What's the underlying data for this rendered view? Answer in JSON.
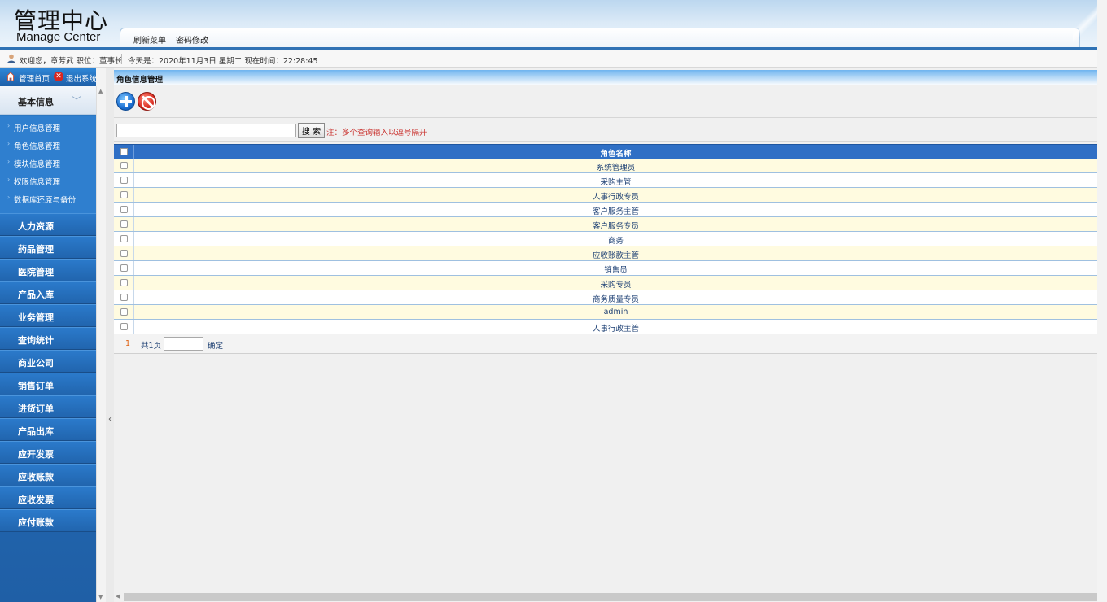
{
  "header": {
    "title": "管理中心",
    "subtitle": "Manage Center",
    "tabs": [
      "刷新菜单",
      "密码修改"
    ]
  },
  "infobar": {
    "welcome": "欢迎您，章芳武  职位：董事长",
    "datetime": "今天是：2020年11月3日 星期二 现在时间：22:28:45"
  },
  "sidebar": {
    "home_label": "管理首页",
    "exit_label": "退出系统",
    "group_label": "基本信息",
    "sub_items": [
      "用户信息管理",
      "角色信息管理",
      "模块信息管理",
      "权限信息管理",
      "数据库还原与备份"
    ],
    "menu_items": [
      "人力资源",
      "药品管理",
      "医院管理",
      "产品入库",
      "业务管理",
      "查询统计",
      "商业公司",
      "销售订单",
      "进货订单",
      "产品出库",
      "应开发票",
      "应收账款",
      "应收发票",
      "应付账款"
    ]
  },
  "main": {
    "title": "角色信息管理",
    "search_button": "搜 索",
    "search_note": "注：多个查询输入以逗号隔开",
    "column_header": "角色名称",
    "rows": [
      "系统管理员",
      "采购主管",
      "人事行政专员",
      "客户服务主管",
      "客户服务专员",
      "商务",
      "应收账款主管",
      "销售员",
      "采购专员",
      "商务质量专员",
      "admin",
      "人事行政主管"
    ],
    "pager": {
      "current": "1",
      "total": "共1页",
      "go": "确定"
    }
  }
}
